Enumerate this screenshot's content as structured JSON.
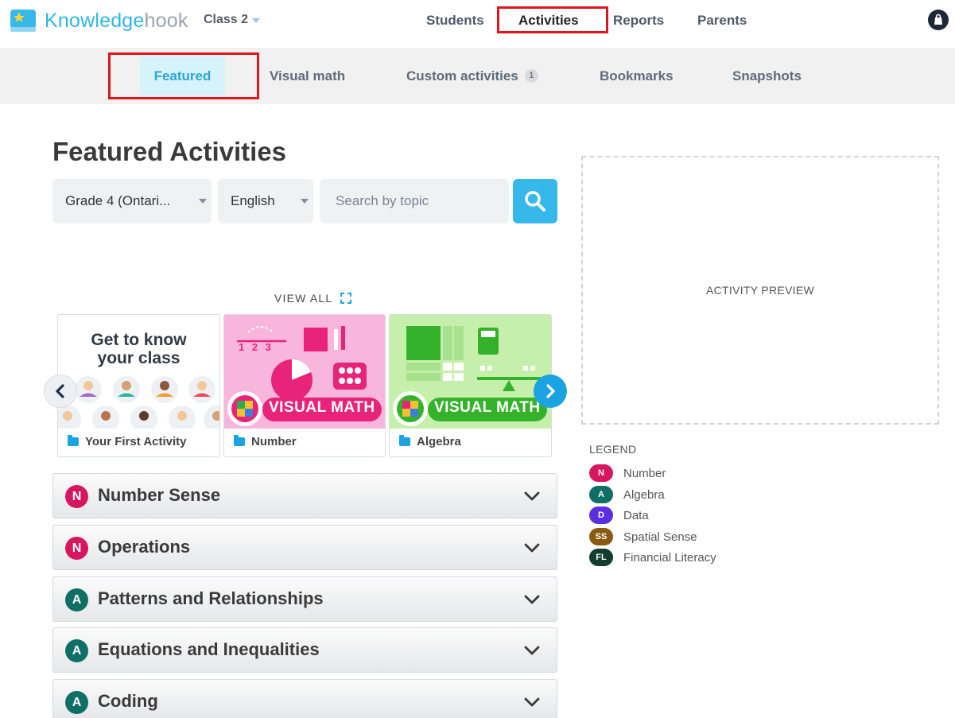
{
  "brand": {
    "part1": "Knowledge",
    "part2": "hook"
  },
  "class_selector": {
    "label": "Class 2"
  },
  "topnav": {
    "students": "Students",
    "activities": "Activities",
    "reports": "Reports",
    "parents": "Parents"
  },
  "subnav": {
    "featured": "Featured",
    "visual_math": "Visual math",
    "custom": "Custom activities",
    "custom_count": "1",
    "bookmarks": "Bookmarks",
    "snapshots": "Snapshots"
  },
  "main": {
    "title": "Featured Activities",
    "grade_select": "Grade 4 (Ontari...",
    "language_select": "English",
    "search_placeholder": "Search by topic",
    "view_all": "VIEW ALL"
  },
  "cards": [
    {
      "img_title_line1": "Get to know",
      "img_title_line2": "your class",
      "label": "Your First Activity"
    },
    {
      "img_title": "VISUAL MATH",
      "label": "Number",
      "number_line": "1 2 3"
    },
    {
      "img_title": "VISUAL MATH",
      "label": "Algebra"
    }
  ],
  "accordions": [
    {
      "badge": "N",
      "title": "Number Sense"
    },
    {
      "badge": "N",
      "title": "Operations"
    },
    {
      "badge": "A",
      "title": "Patterns and Relationships"
    },
    {
      "badge": "A",
      "title": "Equations and Inequalities"
    },
    {
      "badge": "A",
      "title": "Coding"
    }
  ],
  "preview": {
    "label": "ACTIVITY PREVIEW"
  },
  "legend": {
    "title": "LEGEND",
    "items": [
      {
        "abbr": "N",
        "name": "Number",
        "color": "#d6175f"
      },
      {
        "abbr": "A",
        "name": "Algebra",
        "color": "#0f6e66"
      },
      {
        "abbr": "D",
        "name": "Data",
        "color": "#5b2ee0"
      },
      {
        "abbr": "SS",
        "name": "Spatial Sense",
        "color": "#8a5a10"
      },
      {
        "abbr": "FL",
        "name": "Financial Literacy",
        "color": "#123c2e"
      }
    ]
  },
  "colors": {
    "accent": "#36b8ea",
    "highlight": "#e0151c",
    "number": "#d6175f",
    "algebra": "#0f6e66"
  }
}
